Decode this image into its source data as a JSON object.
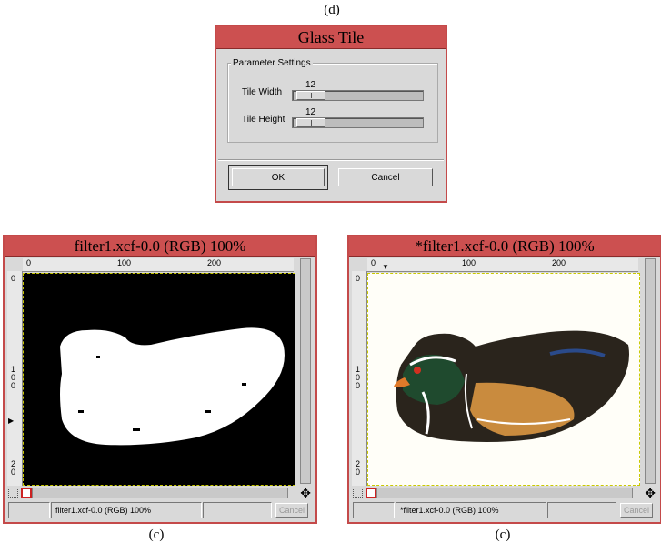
{
  "captions": {
    "top": "(d)",
    "left": "(c)",
    "right": "(c)"
  },
  "dialog": {
    "title": "Glass Tile",
    "group_label": "Parameter Settings",
    "tile_width": {
      "label": "Tile Width",
      "value": "12"
    },
    "tile_height": {
      "label": "Tile Height",
      "value": "12"
    },
    "ok_label": "OK",
    "cancel_label": "Cancel"
  },
  "left_window": {
    "title": "filter1.xcf-0.0 (RGB) 100%",
    "status": "filter1.xcf-0.0 (RGB) 100%",
    "cancel_label": "Cancel",
    "ruler_h": [
      "0",
      "100",
      "200"
    ],
    "ruler_v": [
      "0",
      "1\n0\n0",
      "2\n0"
    ]
  },
  "right_window": {
    "title": "*filter1.xcf-0.0 (RGB) 100%",
    "status": "*filter1.xcf-0.0 (RGB) 100%",
    "cancel_label": "Cancel",
    "ruler_h": [
      "0",
      "100",
      "200"
    ],
    "ruler_v": [
      "0",
      "1\n0\n0",
      "2\n0"
    ]
  },
  "colors": {
    "title_bar": "#cc5050",
    "window_bg": "#d9d9d9",
    "mask_bg": "#000000",
    "mask_fg": "#ffffff"
  },
  "icons": [
    "navigate-icon",
    "quick-mask-icon",
    "scroll-arrow-icon"
  ]
}
